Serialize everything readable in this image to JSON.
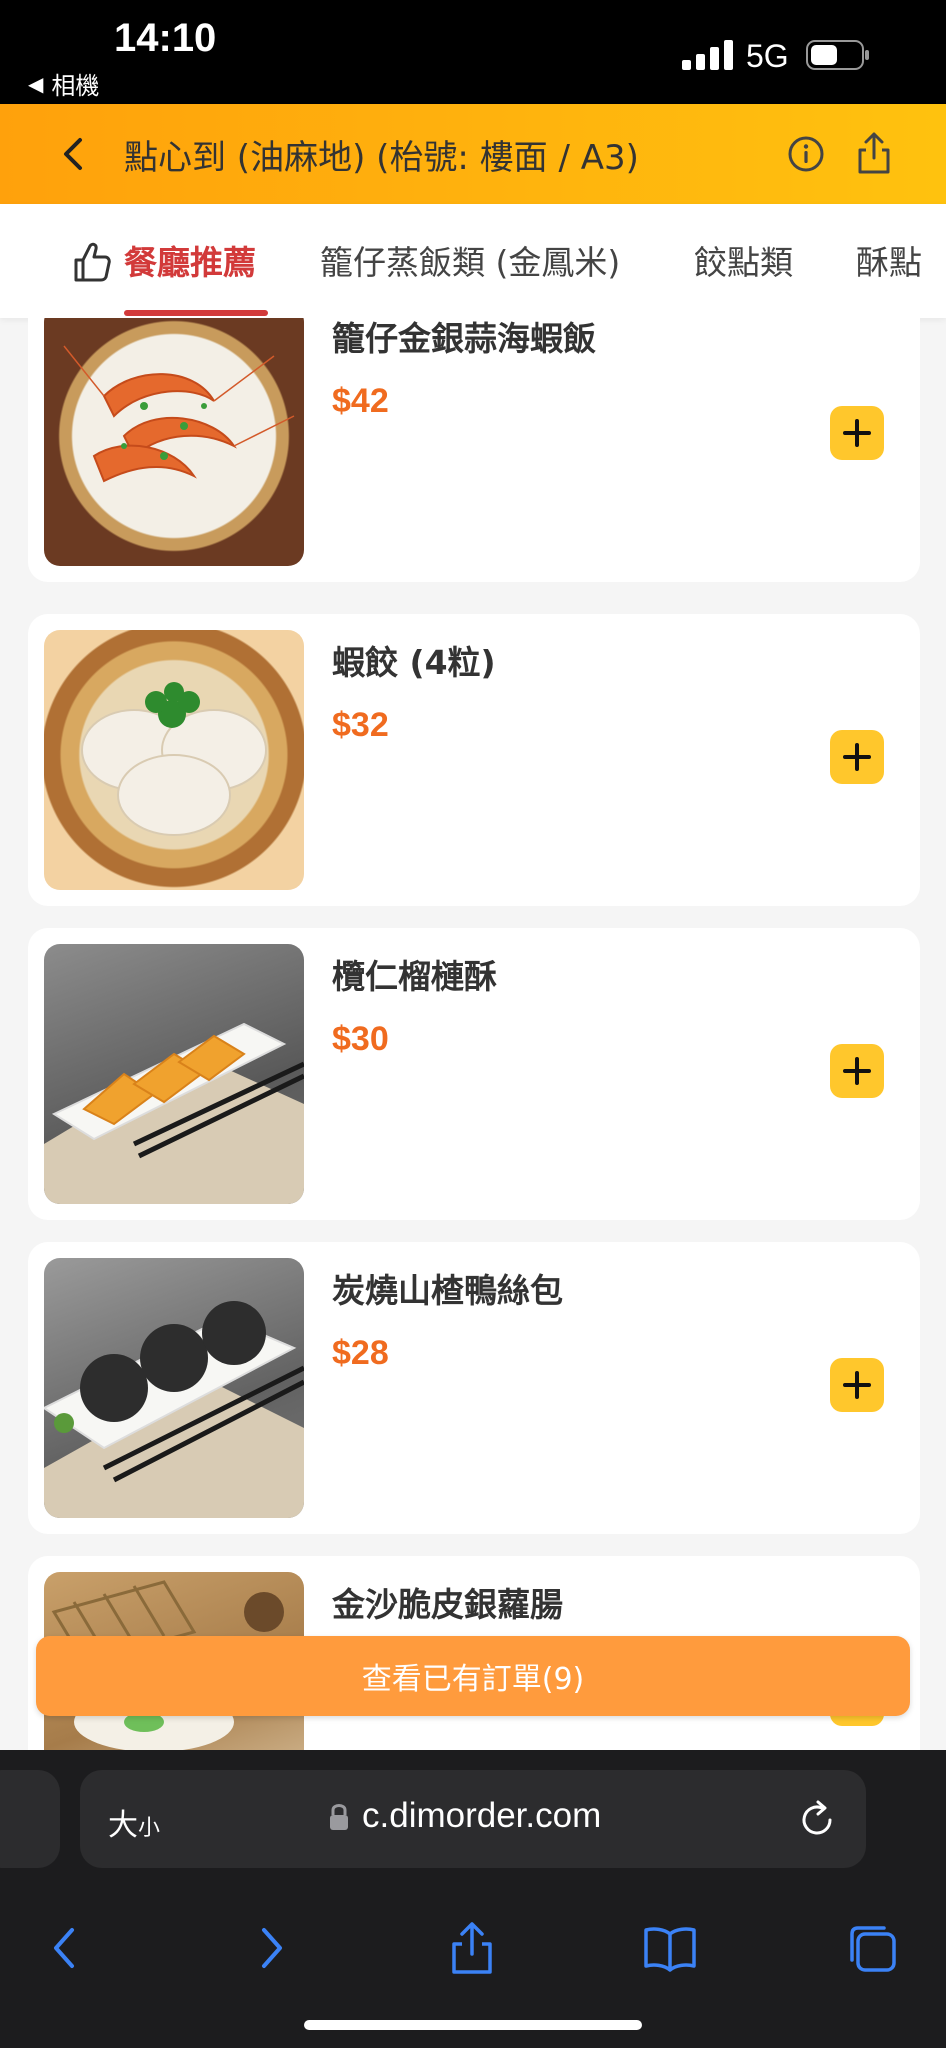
{
  "status_bar": {
    "time": "14:10",
    "back_app": "相機",
    "network": "5G"
  },
  "header": {
    "title": "點心到 (油麻地) (枱號: 樓面 / A3)"
  },
  "tabs": [
    {
      "label": "餐廳推薦",
      "active": true
    },
    {
      "label": "籠仔蒸飯類 (金鳳米)",
      "active": false
    },
    {
      "label": "餃點類",
      "active": false
    },
    {
      "label": "酥點",
      "active": false
    }
  ],
  "menu_items": [
    {
      "name": "籠仔金銀蒜海蝦飯",
      "price": "$42"
    },
    {
      "name": "蝦餃 (4粒)",
      "price": "$32"
    },
    {
      "name": "欖仁榴槤酥",
      "price": "$30"
    },
    {
      "name": "炭燒山楂鴨絲包",
      "price": "$28"
    },
    {
      "name": "金沙脆皮銀蘿腸",
      "price": ""
    }
  ],
  "order_button": {
    "label": "查看已有訂單(9)"
  },
  "browser": {
    "text_size_label": "大",
    "text_size_small": "小",
    "url": "c.dimorder.com"
  },
  "colors": {
    "header_gradient_start": "#ffa10c",
    "header_gradient_end": "#ffc20e",
    "active_tab": "#d23a3a",
    "price": "#f06b1f",
    "add_button": "#ffc72c",
    "order_button": "#ff9b3d"
  }
}
